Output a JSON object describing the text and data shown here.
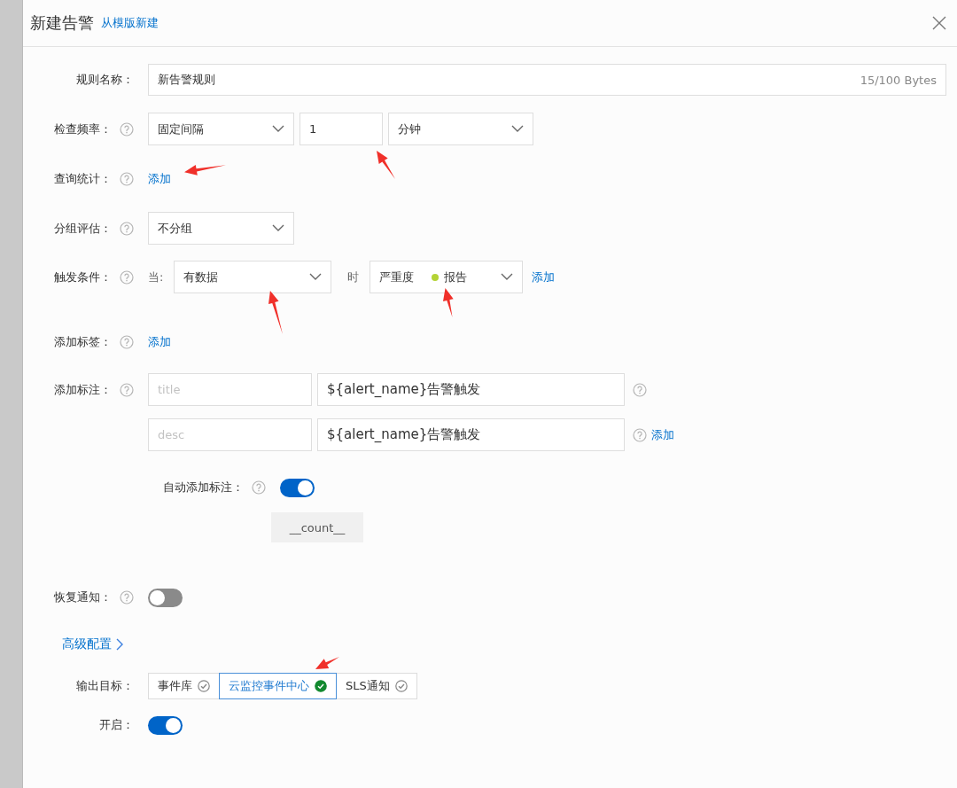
{
  "dialog": {
    "title": "新建告警",
    "template_link": "从模版新建"
  },
  "rule_name": {
    "label": "规则名称：",
    "value": "新告警规则",
    "counter": "15/100 Bytes"
  },
  "check_frequency": {
    "label": "检查频率：",
    "mode": "固定间隔",
    "interval": "1",
    "unit": "分钟"
  },
  "query": {
    "label": "查询统计：",
    "add_link": "添加"
  },
  "grouping": {
    "label": "分组评估：",
    "value": "不分组"
  },
  "trigger": {
    "label": "触发条件：",
    "when_label": "当:",
    "condition": "有数据",
    "time_label": "时",
    "severity_label": "严重度",
    "severity": {
      "text": "报告",
      "color": "#b4d335"
    },
    "add_link": "添加"
  },
  "labels": {
    "label": "添加标签：",
    "add_link": "添加"
  },
  "annotations": {
    "label": "添加标注：",
    "rows": [
      {
        "key_placeholder": "title",
        "value": "${alert_name}告警触发"
      },
      {
        "key_placeholder": "desc",
        "value": "${alert_name}告警触发"
      }
    ],
    "add_link": "添加"
  },
  "auto_annotation": {
    "label": "自动添加标注：",
    "on": true,
    "tags": [
      "__count__"
    ]
  },
  "recovery": {
    "label": "恢复通知：",
    "on": false
  },
  "advanced": {
    "label": "高级配置"
  },
  "output": {
    "label": "输出目标：",
    "targets": [
      {
        "label": "事件库",
        "selected": false
      },
      {
        "label": "云监控事件中心",
        "selected": true
      },
      {
        "label": "SLS通知",
        "selected": false
      }
    ]
  },
  "enabled": {
    "label": "开启：",
    "on": true
  }
}
